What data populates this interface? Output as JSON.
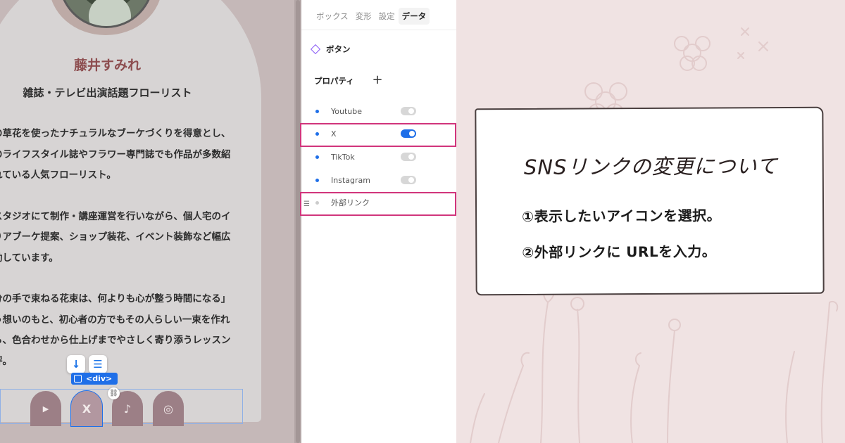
{
  "profile": {
    "name": "藤井すみれ",
    "subtitle": "雑誌・テレビ出演話題フローリスト",
    "bio_lines": [
      "の草花を使ったナチュラルなブーケづくりを得意とし、",
      "のライフスタイル誌やフラワー専門誌でも作品が多数紹",
      "れている人気フローリスト。",
      "スタジオにて制作・講座運営を行いながら、個人宅のイ",
      "りアブーケ提案、ショップ装花、イベント装飾など幅広",
      "動しています。",
      "分の手で束ねる花束は、何よりも心が整う時間になる」",
      "う想いのもと、初心者の方でもその人らしい一束を作れ",
      "ら、色合わせから仕上げまでやさしく寄り添うレッスン",
      "評。"
    ],
    "selection_tag": "<div>",
    "social_icons": [
      "youtube-icon",
      "x-icon",
      "tiktok-icon",
      "instagram-icon"
    ],
    "social_glyphs": [
      "▶",
      "X",
      "♪",
      "◎"
    ]
  },
  "panel": {
    "tabs": [
      "ボックス",
      "変形",
      "設定",
      "データ"
    ],
    "active_tab": "データ",
    "element_name": "ボタン",
    "properties_label": "プロパティ",
    "add_label": "+",
    "properties": [
      {
        "label": "Youtube",
        "enabled": false
      },
      {
        "label": "X",
        "enabled": true
      },
      {
        "label": "TikTok",
        "enabled": false
      },
      {
        "label": "Instagram",
        "enabled": false
      }
    ],
    "external_link_label": "外部リンク"
  },
  "note": {
    "title": "SNSリンクの変更について",
    "step1": "①表示したいアイコンを選択。",
    "step2": "②外部リンクに URLを入力。"
  },
  "colors": {
    "accent": "#1f6fe8",
    "highlight": "#d1357c",
    "name_color": "#8d4d4f",
    "social_bg": "#9c7f86"
  }
}
